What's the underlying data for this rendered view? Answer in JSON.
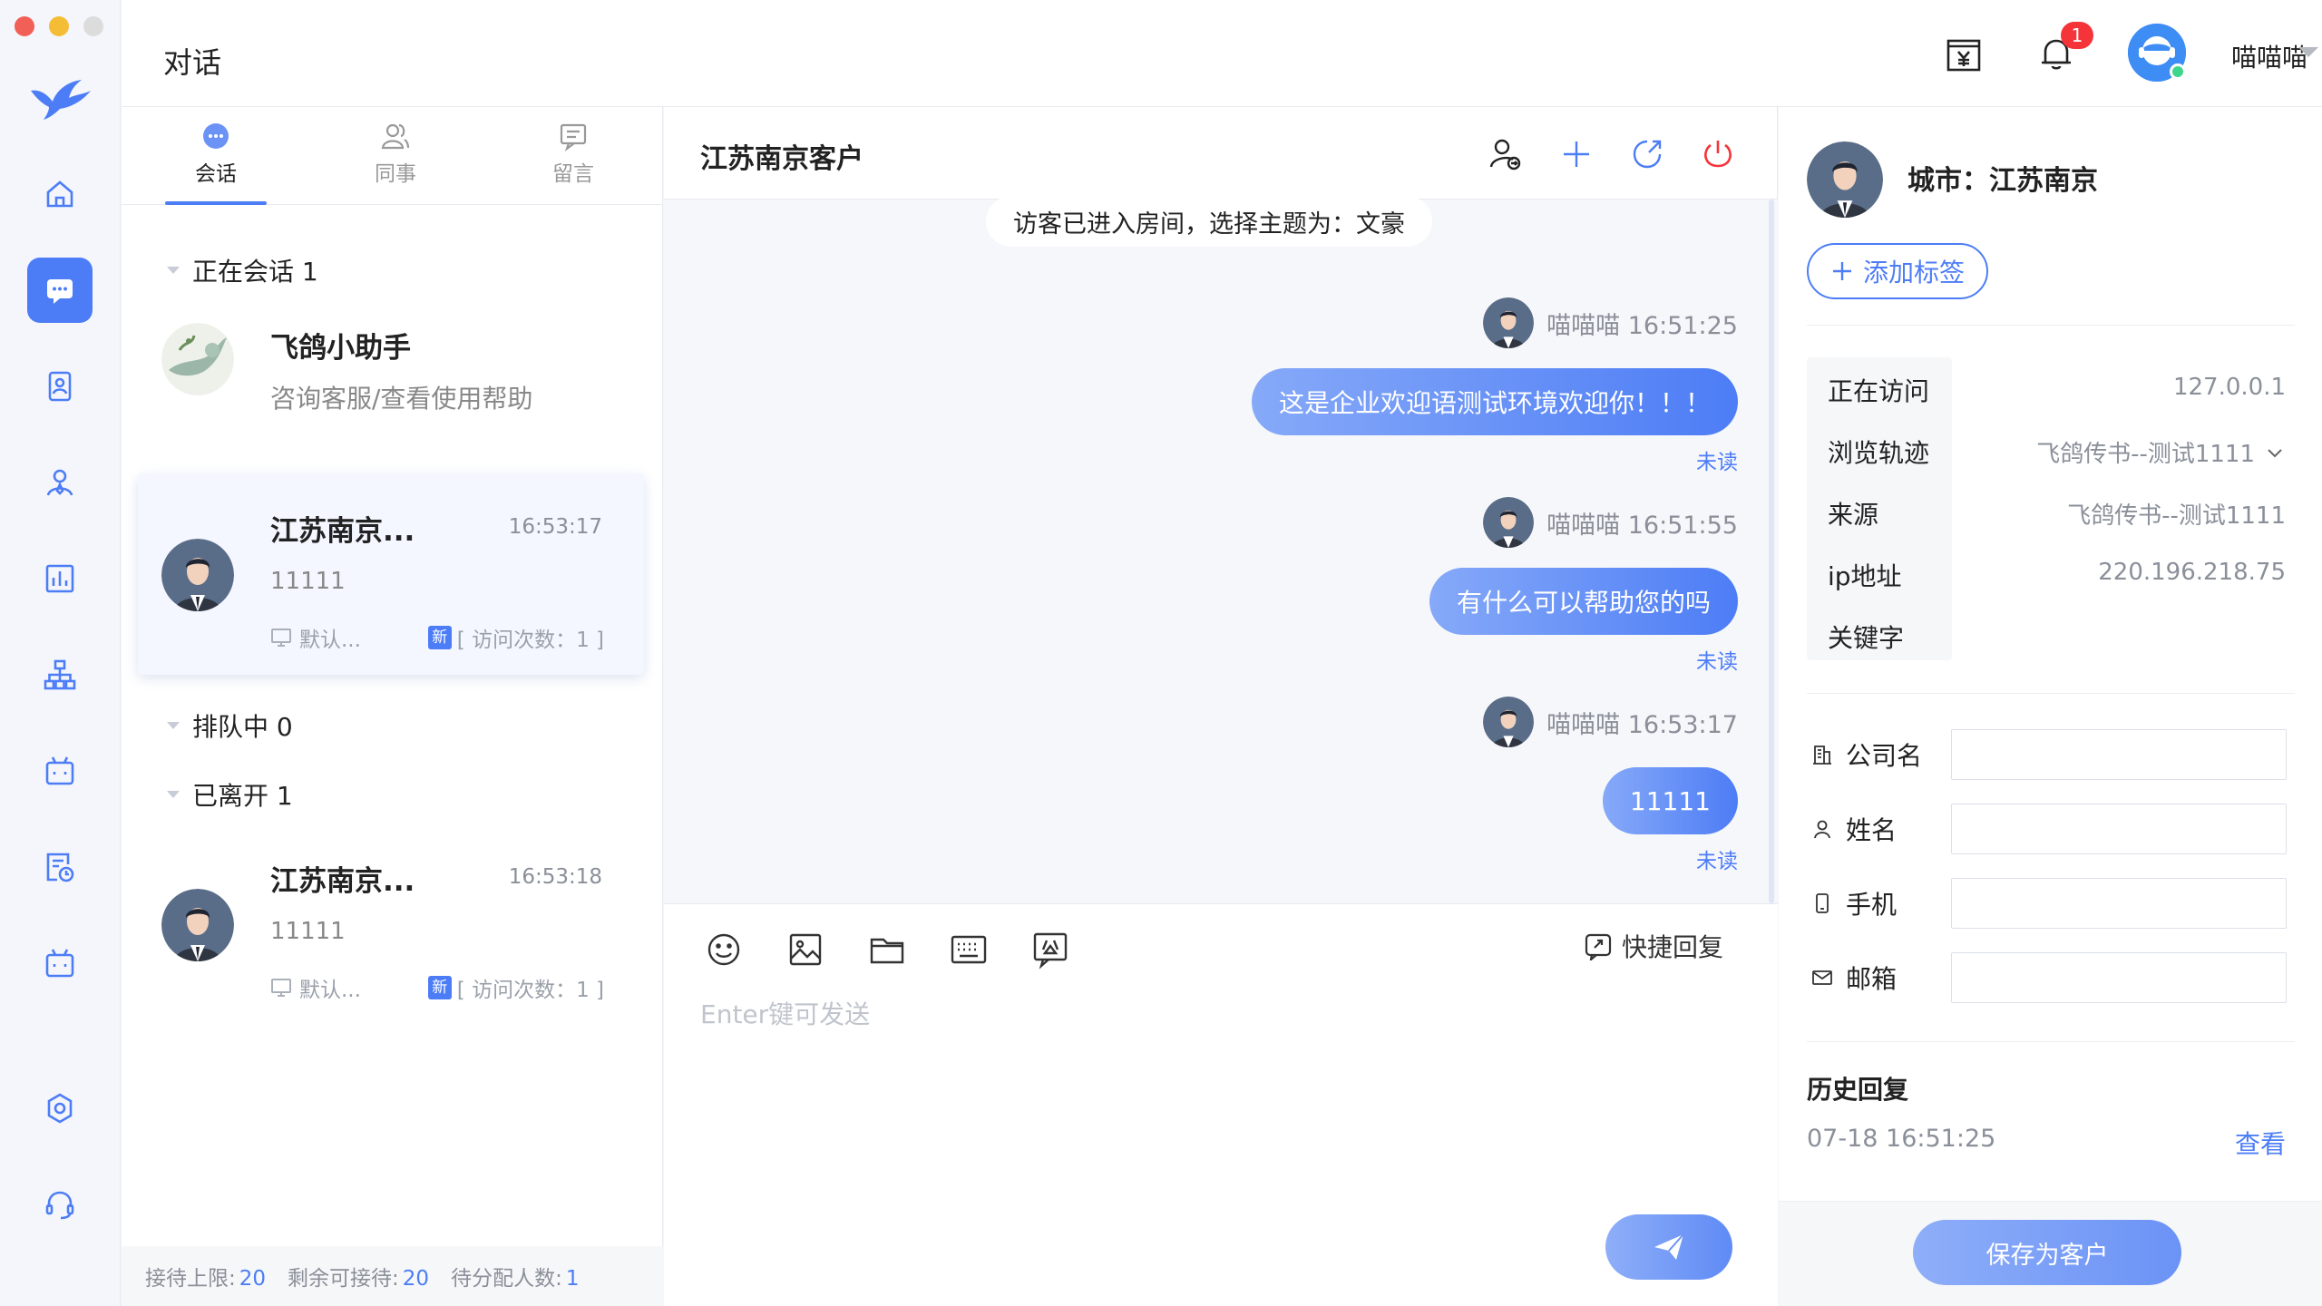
{
  "app": {
    "window_title": "对话"
  },
  "colors": {
    "accent": "#4d7df6",
    "badge": "#f5343a",
    "online": "#3dd68c"
  },
  "rail": {
    "icons": [
      "home-icon",
      "chat-icon",
      "contact-card-icon",
      "user-icon",
      "stats-icon",
      "org-icon",
      "bot-icon",
      "report-icon",
      "bot2-icon",
      "settings-icon",
      "headset-icon"
    ],
    "active": "chat-icon"
  },
  "header": {
    "notification_count": "1",
    "username": "喵喵喵"
  },
  "tabs": [
    {
      "label": "会话",
      "active": true
    },
    {
      "label": "同事",
      "active": false
    },
    {
      "label": "留言",
      "active": false
    }
  ],
  "groups": {
    "ongoing": "正在会话 1",
    "queue": "排队中 0",
    "left": "已离开 1"
  },
  "sessions": {
    "assistant": {
      "name": "飞鸽小助手",
      "sub": "咨询客服/查看使用帮助"
    },
    "ongoing": {
      "name": "江苏南京...",
      "time": "16:53:17",
      "last": "11111",
      "channel": "默认...",
      "new_tag": "新",
      "visits": "[ 访问次数：1 ]"
    },
    "left": {
      "name": "江苏南京...",
      "time": "16:53:18",
      "last": "11111",
      "channel": "默认...",
      "new_tag": "新",
      "visits": "[ 访问次数：1 ]"
    }
  },
  "status_bar": {
    "limit_label": "接待上限:",
    "limit": "20",
    "remain_label": "剩余可接待:",
    "remain": "20",
    "pending_label": "待分配人数:",
    "pending": "1"
  },
  "chat": {
    "title": "江苏南京客户",
    "system_message": "访客已进入房间，选择主题为：文豪",
    "messages": [
      {
        "meta": "喵喵喵 16:51:25",
        "text": "这是企业欢迎语测试环境欢迎你！！！",
        "status": "未读"
      },
      {
        "meta": "喵喵喵 16:51:55",
        "text": "有什么可以帮助您的吗",
        "status": "未读"
      },
      {
        "meta": "喵喵喵 16:53:17",
        "text": "11111",
        "status": "未读"
      }
    ],
    "quick_reply": "快捷回复",
    "composer_placeholder": "Enter键可发送"
  },
  "info": {
    "city": "城市：江苏南京",
    "add_tag": "添加标签",
    "visit": [
      {
        "label": "正在访问",
        "value": "127.0.0.1"
      },
      {
        "label": "浏览轨迹",
        "value": "飞鸽传书--测试1111"
      },
      {
        "label": "来源",
        "value": "飞鸽传书--测试1111"
      },
      {
        "label": "ip地址",
        "value": "220.196.218.75"
      },
      {
        "label": "关键字",
        "value": ""
      }
    ],
    "fields": [
      {
        "label": "公司名",
        "icon": "building-icon",
        "value": ""
      },
      {
        "label": "姓名",
        "icon": "person-icon",
        "value": ""
      },
      {
        "label": "手机",
        "icon": "phone-icon",
        "value": ""
      },
      {
        "label": "邮箱",
        "icon": "mail-icon",
        "value": ""
      }
    ],
    "history_title": "历史回复",
    "history_time": "07-18 16:51:25",
    "history_view": "查看",
    "save_button": "保存为客户"
  }
}
